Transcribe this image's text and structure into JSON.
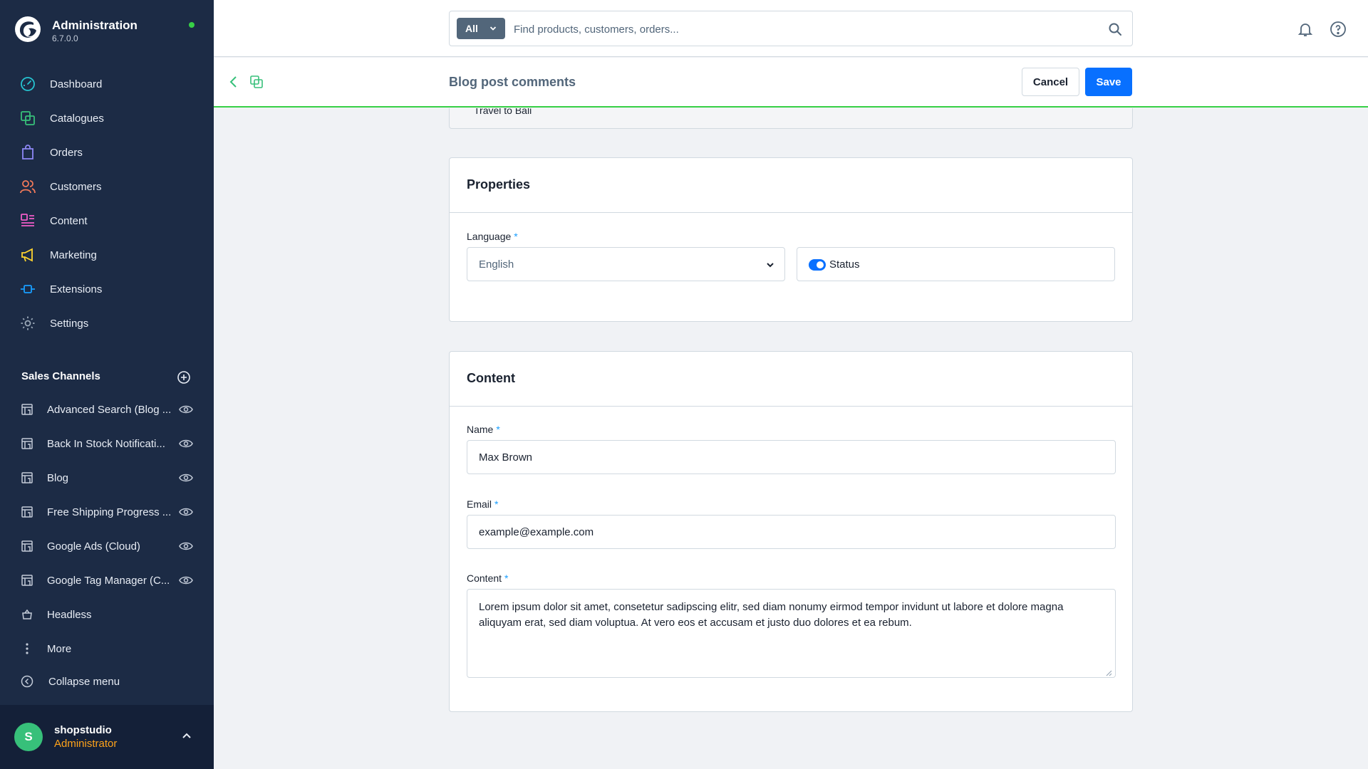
{
  "brand": {
    "title": "Administration",
    "version": "6.7.0.0",
    "status_color": "#37d046"
  },
  "nav": [
    {
      "label": "Dashboard",
      "icon": "dashboard-icon"
    },
    {
      "label": "Catalogues",
      "icon": "catalogue-icon"
    },
    {
      "label": "Orders",
      "icon": "orders-icon"
    },
    {
      "label": "Customers",
      "icon": "customers-icon"
    },
    {
      "label": "Content",
      "icon": "content-icon"
    },
    {
      "label": "Marketing",
      "icon": "marketing-icon"
    },
    {
      "label": "Extensions",
      "icon": "extensions-icon"
    },
    {
      "label": "Settings",
      "icon": "settings-icon"
    }
  ],
  "sales_channels": {
    "title": "Sales Channels",
    "items": [
      {
        "label": "Advanced Search (Blog ...",
        "icon": "storefront-icon"
      },
      {
        "label": "Back In Stock Notificati...",
        "icon": "storefront-icon"
      },
      {
        "label": "Blog",
        "icon": "storefront-icon"
      },
      {
        "label": "Free Shipping Progress ...",
        "icon": "storefront-icon"
      },
      {
        "label": "Google Ads (Cloud)",
        "icon": "storefront-icon"
      },
      {
        "label": "Google Tag Manager (C...",
        "icon": "storefront-icon"
      },
      {
        "label": "Headless",
        "icon": "headless-icon"
      },
      {
        "label": "More",
        "icon": "more-icon"
      }
    ],
    "collapse_label": "Collapse menu"
  },
  "user": {
    "initial": "S",
    "name": "shopstudio",
    "role": "Administrator"
  },
  "search": {
    "type_label": "All",
    "placeholder": "Find products, customers, orders..."
  },
  "smartbar": {
    "title": "Blog post comments",
    "cancel_label": "Cancel",
    "save_label": "Save"
  },
  "previous_card": {
    "text": "Travel to Bali"
  },
  "properties": {
    "title": "Properties",
    "language_label": "Language",
    "language_value": "English",
    "status_label": "Status"
  },
  "content": {
    "title": "Content",
    "name_label": "Name",
    "name_value": "Max Brown",
    "email_label": "Email",
    "email_value": "example@example.com",
    "content_label": "Content",
    "content_value": "Lorem ipsum dolor sit amet, consetetur sadipscing elitr, sed diam nonumy eirmod tempor invidunt ut labore et dolore magna aliquyam erat, sed diam voluptua. At vero eos et accusam et justo duo dolores et ea rebum."
  },
  "required_marker": "*",
  "colors": {
    "sidebar_bg": "#1c2b45",
    "primary": "#0870ff",
    "accent": "#37d046",
    "role": "#ffa31a"
  }
}
